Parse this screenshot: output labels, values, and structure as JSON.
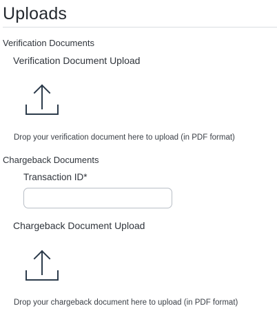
{
  "page": {
    "title": "Uploads"
  },
  "verification": {
    "section_title": "Verification Documents",
    "upload_label": "Verification Document Upload",
    "upload_icon": "upload-icon",
    "hint": "Drop your verification document here to upload (in PDF format)"
  },
  "chargeback": {
    "section_title": "Chargeback Documents",
    "transaction_label": "Transaction ID*",
    "transaction_value": "",
    "upload_label": "Chargeback Document Upload",
    "upload_icon": "upload-icon",
    "hint": "Drop your chargeback document here to upload (in PDF format)"
  },
  "colors": {
    "icon_stroke": "#2b3a4a",
    "divider": "#d9dde2",
    "input_border": "#b8bec6"
  }
}
